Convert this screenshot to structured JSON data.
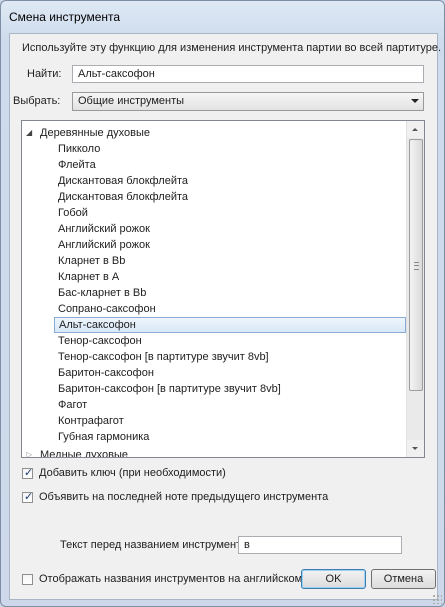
{
  "window": {
    "title": "Смена инструмента"
  },
  "description": "Используйте эту функцию для изменения инструмента партии во всей партитуре.",
  "find": {
    "label": "Найти:",
    "value": "Альт-саксофон"
  },
  "choose": {
    "label": "Выбрать:",
    "selected": "Общие инструменты"
  },
  "tree": {
    "group_expanded": "Деревянные духовые",
    "items": [
      "Пикколо",
      "Флейта",
      "Дискантовая блокфлейта",
      "Дискантовая блокфлейта",
      "Гобой",
      "Английский рожок",
      "Английский рожок",
      "Кларнет в Bb",
      "Кларнет в A",
      "Бас-кларнет в Bb",
      "Сопрано-саксофон",
      "Альт-саксофон",
      "Тенор-саксофон",
      "Тенор-саксофон [в партитуре звучит 8vb]",
      "Баритон-саксофон",
      "Баритон-саксофон [в партитуре звучит 8vb]",
      "Фагот",
      "Контрафагот",
      "Губная гармоника"
    ],
    "selected_index": 11,
    "group_collapsed": "Медные духовые"
  },
  "options": {
    "add_clef": {
      "label": "Добавить ключ (при необходимости)",
      "checked": true
    },
    "announce": {
      "label": "Объявить на последней ноте предыдущего инструмента",
      "checked": true
    },
    "prefix_label": "Текст перед названием инструмента:",
    "prefix_value": "в",
    "english_names": {
      "label": "Отображать названия инструментов на английском",
      "checked": false
    }
  },
  "buttons": {
    "ok": "OK",
    "cancel": "Отмена"
  },
  "colors": {
    "selection_fill": "#d9e8f8",
    "selection_border": "#88abd6",
    "window_frame": "#cddbec"
  }
}
